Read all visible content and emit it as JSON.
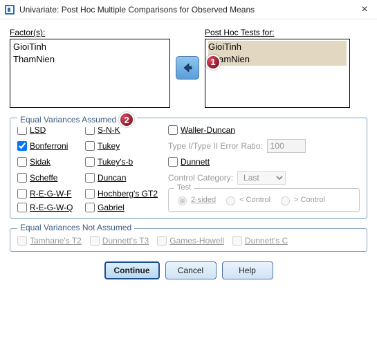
{
  "window": {
    "title": "Univariate: Post Hoc Multiple Comparisons for Observed Means"
  },
  "labels": {
    "factors": "Factor(s):",
    "posthoc_for": "Post Hoc Tests for:"
  },
  "factors_list": {
    "i0": "GioiTinh",
    "i1": "ThamNien"
  },
  "posthoc_list": {
    "i0": "GioiTinh",
    "i1": "ThamNien"
  },
  "badges": {
    "b1": "1",
    "b2": "2"
  },
  "equal_assumed": {
    "legend": "Equal Variances Assumed",
    "lsd": "LSD",
    "snk": "S-N-K",
    "waller": "Waller-Duncan",
    "bonferroni": "Bonferroni",
    "tukey": "Tukey",
    "ratio_label": "Type I/Type II Error Ratio:",
    "ratio_value": "100",
    "sidak": "Sidak",
    "tukeysb": "Tukey's-b",
    "dunnett": "Dunnett",
    "scheffe": "Scheffe",
    "duncan": "Duncan",
    "control_cat": "Control Category:",
    "control_value": "Last",
    "regwf": "R-E-G-W-F",
    "hochberg": "Hochberg's GT2",
    "regwq": "R-E-G-W-Q",
    "gabriel": "Gabriel",
    "test_legend": "Test",
    "twosided": "2-sided",
    "ltcontrol": "< Control",
    "gtcontrol": "> Control"
  },
  "not_assumed": {
    "legend": "Equal Variances Not Assumed",
    "tamhane": "Tamhane's T2",
    "dunnett_t3": "Dunnett's T3",
    "games": "Games-Howell",
    "dunnett_c": "Dunnett's C"
  },
  "buttons": {
    "continue": "Continue",
    "cancel": "Cancel",
    "help": "Help"
  }
}
